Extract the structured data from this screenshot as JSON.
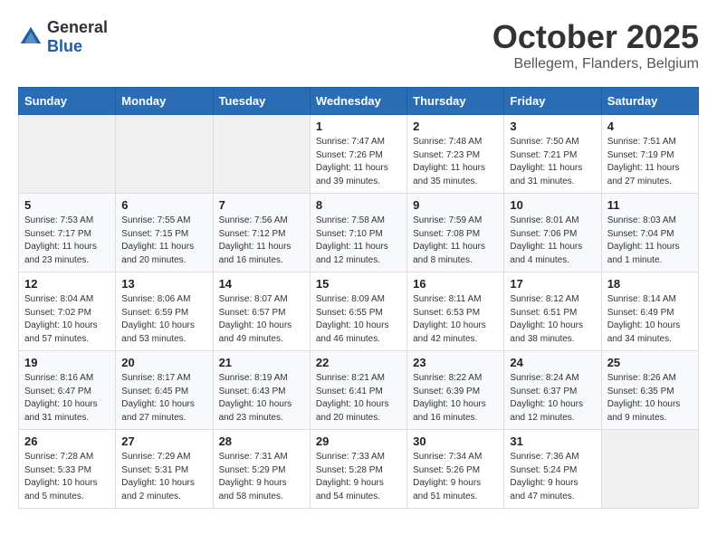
{
  "header": {
    "logo_general": "General",
    "logo_blue": "Blue",
    "title": "October 2025",
    "subtitle": "Bellegem, Flanders, Belgium"
  },
  "weekdays": [
    "Sunday",
    "Monday",
    "Tuesday",
    "Wednesday",
    "Thursday",
    "Friday",
    "Saturday"
  ],
  "weeks": [
    [
      {
        "day": "",
        "detail": ""
      },
      {
        "day": "",
        "detail": ""
      },
      {
        "day": "",
        "detail": ""
      },
      {
        "day": "1",
        "detail": "Sunrise: 7:47 AM\nSunset: 7:26 PM\nDaylight: 11 hours\nand 39 minutes."
      },
      {
        "day": "2",
        "detail": "Sunrise: 7:48 AM\nSunset: 7:23 PM\nDaylight: 11 hours\nand 35 minutes."
      },
      {
        "day": "3",
        "detail": "Sunrise: 7:50 AM\nSunset: 7:21 PM\nDaylight: 11 hours\nand 31 minutes."
      },
      {
        "day": "4",
        "detail": "Sunrise: 7:51 AM\nSunset: 7:19 PM\nDaylight: 11 hours\nand 27 minutes."
      }
    ],
    [
      {
        "day": "5",
        "detail": "Sunrise: 7:53 AM\nSunset: 7:17 PM\nDaylight: 11 hours\nand 23 minutes."
      },
      {
        "day": "6",
        "detail": "Sunrise: 7:55 AM\nSunset: 7:15 PM\nDaylight: 11 hours\nand 20 minutes."
      },
      {
        "day": "7",
        "detail": "Sunrise: 7:56 AM\nSunset: 7:12 PM\nDaylight: 11 hours\nand 16 minutes."
      },
      {
        "day": "8",
        "detail": "Sunrise: 7:58 AM\nSunset: 7:10 PM\nDaylight: 11 hours\nand 12 minutes."
      },
      {
        "day": "9",
        "detail": "Sunrise: 7:59 AM\nSunset: 7:08 PM\nDaylight: 11 hours\nand 8 minutes."
      },
      {
        "day": "10",
        "detail": "Sunrise: 8:01 AM\nSunset: 7:06 PM\nDaylight: 11 hours\nand 4 minutes."
      },
      {
        "day": "11",
        "detail": "Sunrise: 8:03 AM\nSunset: 7:04 PM\nDaylight: 11 hours\nand 1 minute."
      }
    ],
    [
      {
        "day": "12",
        "detail": "Sunrise: 8:04 AM\nSunset: 7:02 PM\nDaylight: 10 hours\nand 57 minutes."
      },
      {
        "day": "13",
        "detail": "Sunrise: 8:06 AM\nSunset: 6:59 PM\nDaylight: 10 hours\nand 53 minutes."
      },
      {
        "day": "14",
        "detail": "Sunrise: 8:07 AM\nSunset: 6:57 PM\nDaylight: 10 hours\nand 49 minutes."
      },
      {
        "day": "15",
        "detail": "Sunrise: 8:09 AM\nSunset: 6:55 PM\nDaylight: 10 hours\nand 46 minutes."
      },
      {
        "day": "16",
        "detail": "Sunrise: 8:11 AM\nSunset: 6:53 PM\nDaylight: 10 hours\nand 42 minutes."
      },
      {
        "day": "17",
        "detail": "Sunrise: 8:12 AM\nSunset: 6:51 PM\nDaylight: 10 hours\nand 38 minutes."
      },
      {
        "day": "18",
        "detail": "Sunrise: 8:14 AM\nSunset: 6:49 PM\nDaylight: 10 hours\nand 34 minutes."
      }
    ],
    [
      {
        "day": "19",
        "detail": "Sunrise: 8:16 AM\nSunset: 6:47 PM\nDaylight: 10 hours\nand 31 minutes."
      },
      {
        "day": "20",
        "detail": "Sunrise: 8:17 AM\nSunset: 6:45 PM\nDaylight: 10 hours\nand 27 minutes."
      },
      {
        "day": "21",
        "detail": "Sunrise: 8:19 AM\nSunset: 6:43 PM\nDaylight: 10 hours\nand 23 minutes."
      },
      {
        "day": "22",
        "detail": "Sunrise: 8:21 AM\nSunset: 6:41 PM\nDaylight: 10 hours\nand 20 minutes."
      },
      {
        "day": "23",
        "detail": "Sunrise: 8:22 AM\nSunset: 6:39 PM\nDaylight: 10 hours\nand 16 minutes."
      },
      {
        "day": "24",
        "detail": "Sunrise: 8:24 AM\nSunset: 6:37 PM\nDaylight: 10 hours\nand 12 minutes."
      },
      {
        "day": "25",
        "detail": "Sunrise: 8:26 AM\nSunset: 6:35 PM\nDaylight: 10 hours\nand 9 minutes."
      }
    ],
    [
      {
        "day": "26",
        "detail": "Sunrise: 7:28 AM\nSunset: 5:33 PM\nDaylight: 10 hours\nand 5 minutes."
      },
      {
        "day": "27",
        "detail": "Sunrise: 7:29 AM\nSunset: 5:31 PM\nDaylight: 10 hours\nand 2 minutes."
      },
      {
        "day": "28",
        "detail": "Sunrise: 7:31 AM\nSunset: 5:29 PM\nDaylight: 9 hours\nand 58 minutes."
      },
      {
        "day": "29",
        "detail": "Sunrise: 7:33 AM\nSunset: 5:28 PM\nDaylight: 9 hours\nand 54 minutes."
      },
      {
        "day": "30",
        "detail": "Sunrise: 7:34 AM\nSunset: 5:26 PM\nDaylight: 9 hours\nand 51 minutes."
      },
      {
        "day": "31",
        "detail": "Sunrise: 7:36 AM\nSunset: 5:24 PM\nDaylight: 9 hours\nand 47 minutes."
      },
      {
        "day": "",
        "detail": ""
      }
    ]
  ]
}
